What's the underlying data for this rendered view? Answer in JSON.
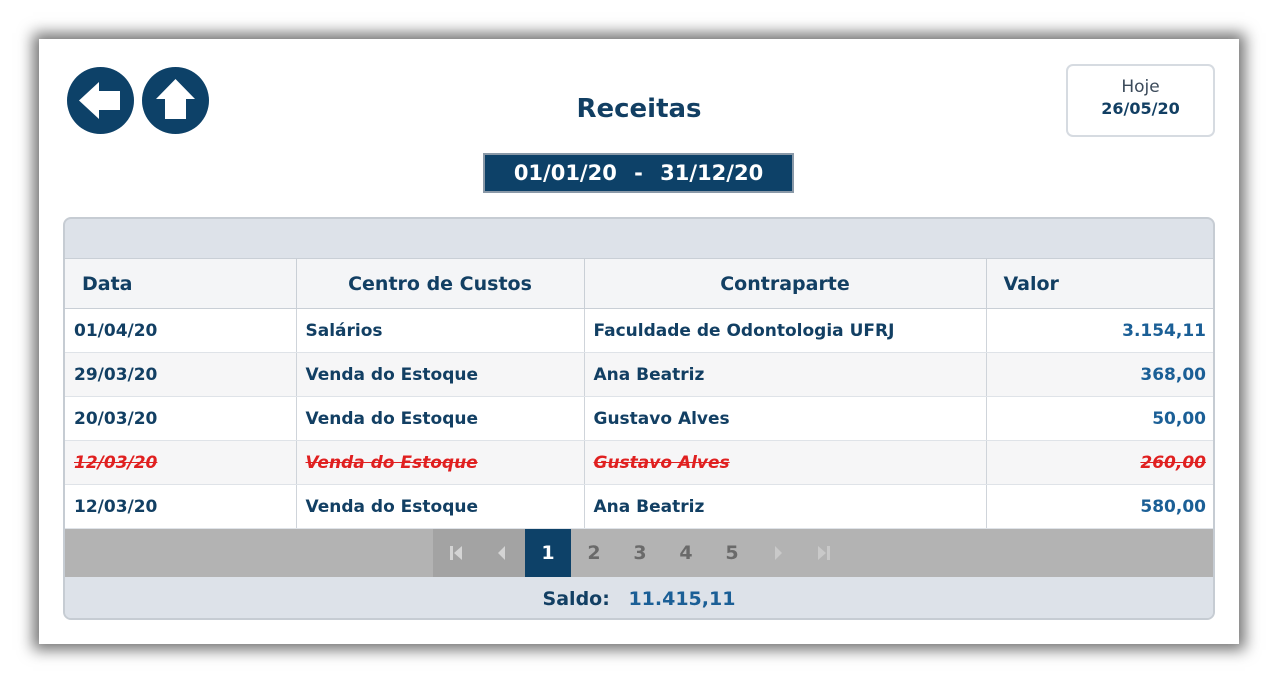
{
  "page": {
    "title": "Receitas"
  },
  "today": {
    "label": "Hoje",
    "date": "26/05/20"
  },
  "date_range": {
    "start": "01/01/20",
    "separator": "-",
    "end": "31/12/20"
  },
  "nav": {
    "back_icon": "arrow-left-icon",
    "home_icon": "arrow-up-icon"
  },
  "table": {
    "headers": {
      "date": "Data",
      "cost_center": "Centro de Custos",
      "counterparty": "Contraparte",
      "value": "Valor"
    },
    "rows": [
      {
        "date": "01/04/20",
        "cost_center": "Salários",
        "counterparty": "Faculdade de Odontologia UFRJ",
        "value": "3.154,11",
        "canceled": false
      },
      {
        "date": "29/03/20",
        "cost_center": "Venda do Estoque",
        "counterparty": "Ana Beatriz",
        "value": "368,00",
        "canceled": false
      },
      {
        "date": "20/03/20",
        "cost_center": "Venda do Estoque",
        "counterparty": "Gustavo Alves",
        "value": "50,00",
        "canceled": false
      },
      {
        "date": "12/03/20",
        "cost_center": "Venda do Estoque",
        "counterparty": "Gustavo Alves",
        "value": "260,00",
        "canceled": true
      },
      {
        "date": "12/03/20",
        "cost_center": "Venda do Estoque",
        "counterparty": "Ana Beatriz",
        "value": "580,00",
        "canceled": false
      }
    ]
  },
  "pagination": {
    "pages": [
      "1",
      "2",
      "3",
      "4",
      "5"
    ],
    "current": "1"
  },
  "summary": {
    "label": "Saldo:",
    "value": "11.415,11"
  },
  "colors": {
    "primary": "#0d4168",
    "canceled": "#e02020",
    "value_text": "#1b5f96"
  }
}
